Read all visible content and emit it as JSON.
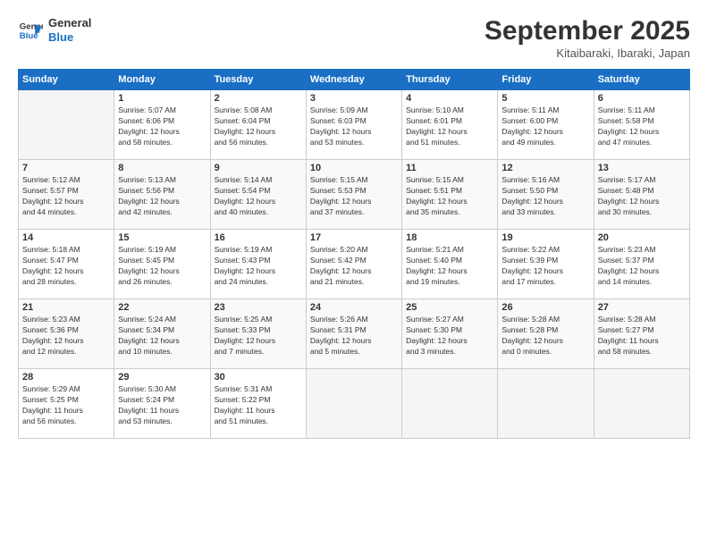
{
  "header": {
    "logo_line1": "General",
    "logo_line2": "Blue",
    "month": "September 2025",
    "location": "Kitaibaraki, Ibaraki, Japan"
  },
  "days_header": [
    "Sunday",
    "Monday",
    "Tuesday",
    "Wednesday",
    "Thursday",
    "Friday",
    "Saturday"
  ],
  "weeks": [
    [
      {
        "num": "",
        "info": ""
      },
      {
        "num": "1",
        "info": "Sunrise: 5:07 AM\nSunset: 6:06 PM\nDaylight: 12 hours\nand 58 minutes."
      },
      {
        "num": "2",
        "info": "Sunrise: 5:08 AM\nSunset: 6:04 PM\nDaylight: 12 hours\nand 56 minutes."
      },
      {
        "num": "3",
        "info": "Sunrise: 5:09 AM\nSunset: 6:03 PM\nDaylight: 12 hours\nand 53 minutes."
      },
      {
        "num": "4",
        "info": "Sunrise: 5:10 AM\nSunset: 6:01 PM\nDaylight: 12 hours\nand 51 minutes."
      },
      {
        "num": "5",
        "info": "Sunrise: 5:11 AM\nSunset: 6:00 PM\nDaylight: 12 hours\nand 49 minutes."
      },
      {
        "num": "6",
        "info": "Sunrise: 5:11 AM\nSunset: 5:58 PM\nDaylight: 12 hours\nand 47 minutes."
      }
    ],
    [
      {
        "num": "7",
        "info": "Sunrise: 5:12 AM\nSunset: 5:57 PM\nDaylight: 12 hours\nand 44 minutes."
      },
      {
        "num": "8",
        "info": "Sunrise: 5:13 AM\nSunset: 5:56 PM\nDaylight: 12 hours\nand 42 minutes."
      },
      {
        "num": "9",
        "info": "Sunrise: 5:14 AM\nSunset: 5:54 PM\nDaylight: 12 hours\nand 40 minutes."
      },
      {
        "num": "10",
        "info": "Sunrise: 5:15 AM\nSunset: 5:53 PM\nDaylight: 12 hours\nand 37 minutes."
      },
      {
        "num": "11",
        "info": "Sunrise: 5:15 AM\nSunset: 5:51 PM\nDaylight: 12 hours\nand 35 minutes."
      },
      {
        "num": "12",
        "info": "Sunrise: 5:16 AM\nSunset: 5:50 PM\nDaylight: 12 hours\nand 33 minutes."
      },
      {
        "num": "13",
        "info": "Sunrise: 5:17 AM\nSunset: 5:48 PM\nDaylight: 12 hours\nand 30 minutes."
      }
    ],
    [
      {
        "num": "14",
        "info": "Sunrise: 5:18 AM\nSunset: 5:47 PM\nDaylight: 12 hours\nand 28 minutes."
      },
      {
        "num": "15",
        "info": "Sunrise: 5:19 AM\nSunset: 5:45 PM\nDaylight: 12 hours\nand 26 minutes."
      },
      {
        "num": "16",
        "info": "Sunrise: 5:19 AM\nSunset: 5:43 PM\nDaylight: 12 hours\nand 24 minutes."
      },
      {
        "num": "17",
        "info": "Sunrise: 5:20 AM\nSunset: 5:42 PM\nDaylight: 12 hours\nand 21 minutes."
      },
      {
        "num": "18",
        "info": "Sunrise: 5:21 AM\nSunset: 5:40 PM\nDaylight: 12 hours\nand 19 minutes."
      },
      {
        "num": "19",
        "info": "Sunrise: 5:22 AM\nSunset: 5:39 PM\nDaylight: 12 hours\nand 17 minutes."
      },
      {
        "num": "20",
        "info": "Sunrise: 5:23 AM\nSunset: 5:37 PM\nDaylight: 12 hours\nand 14 minutes."
      }
    ],
    [
      {
        "num": "21",
        "info": "Sunrise: 5:23 AM\nSunset: 5:36 PM\nDaylight: 12 hours\nand 12 minutes."
      },
      {
        "num": "22",
        "info": "Sunrise: 5:24 AM\nSunset: 5:34 PM\nDaylight: 12 hours\nand 10 minutes."
      },
      {
        "num": "23",
        "info": "Sunrise: 5:25 AM\nSunset: 5:33 PM\nDaylight: 12 hours\nand 7 minutes."
      },
      {
        "num": "24",
        "info": "Sunrise: 5:26 AM\nSunset: 5:31 PM\nDaylight: 12 hours\nand 5 minutes."
      },
      {
        "num": "25",
        "info": "Sunrise: 5:27 AM\nSunset: 5:30 PM\nDaylight: 12 hours\nand 3 minutes."
      },
      {
        "num": "26",
        "info": "Sunrise: 5:28 AM\nSunset: 5:28 PM\nDaylight: 12 hours\nand 0 minutes."
      },
      {
        "num": "27",
        "info": "Sunrise: 5:28 AM\nSunset: 5:27 PM\nDaylight: 11 hours\nand 58 minutes."
      }
    ],
    [
      {
        "num": "28",
        "info": "Sunrise: 5:29 AM\nSunset: 5:25 PM\nDaylight: 11 hours\nand 56 minutes."
      },
      {
        "num": "29",
        "info": "Sunrise: 5:30 AM\nSunset: 5:24 PM\nDaylight: 11 hours\nand 53 minutes."
      },
      {
        "num": "30",
        "info": "Sunrise: 5:31 AM\nSunset: 5:22 PM\nDaylight: 11 hours\nand 51 minutes."
      },
      {
        "num": "",
        "info": ""
      },
      {
        "num": "",
        "info": ""
      },
      {
        "num": "",
        "info": ""
      },
      {
        "num": "",
        "info": ""
      }
    ]
  ]
}
